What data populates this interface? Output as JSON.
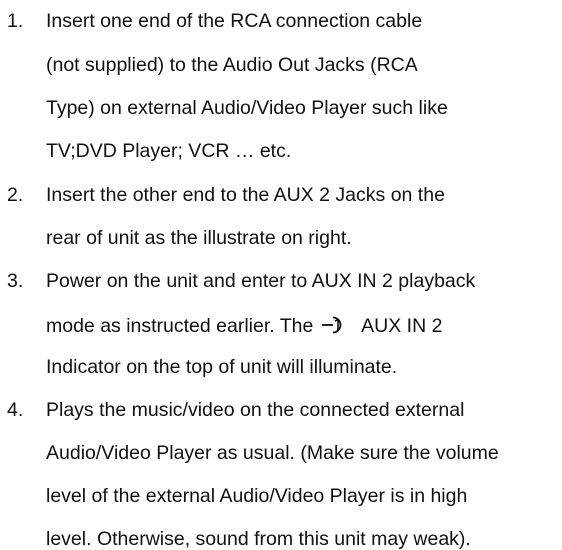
{
  "instructions": [
    {
      "number": "1.",
      "lines": [
        "Insert one end of the RCA connection cable",
        "(not supplied) to the Audio Out Jacks (RCA",
        "Type) on external Audio/Video Player such like",
        "TV;DVD Player; VCR … etc."
      ]
    },
    {
      "number": "2.",
      "lines": [
        "Insert the other end to the AUX 2 Jacks on the",
        "rear of unit as the illustrate on right."
      ]
    },
    {
      "number": "3.",
      "lines": [
        "Power on the unit and enter to AUX IN 2 playback",
        "mode as instructed earlier. The",
        "AUX IN 2",
        "Indicator on the top of unit will illuminate."
      ],
      "icon": "aux-input-jack-icon"
    },
    {
      "number": "4.",
      "lines": [
        "Plays the music/video on the connected external",
        "Audio/Video Player as usual. (Make sure the volume",
        "level of the external Audio/Video Player is in high",
        "level. Otherwise, sound from this unit may weak)."
      ]
    }
  ]
}
